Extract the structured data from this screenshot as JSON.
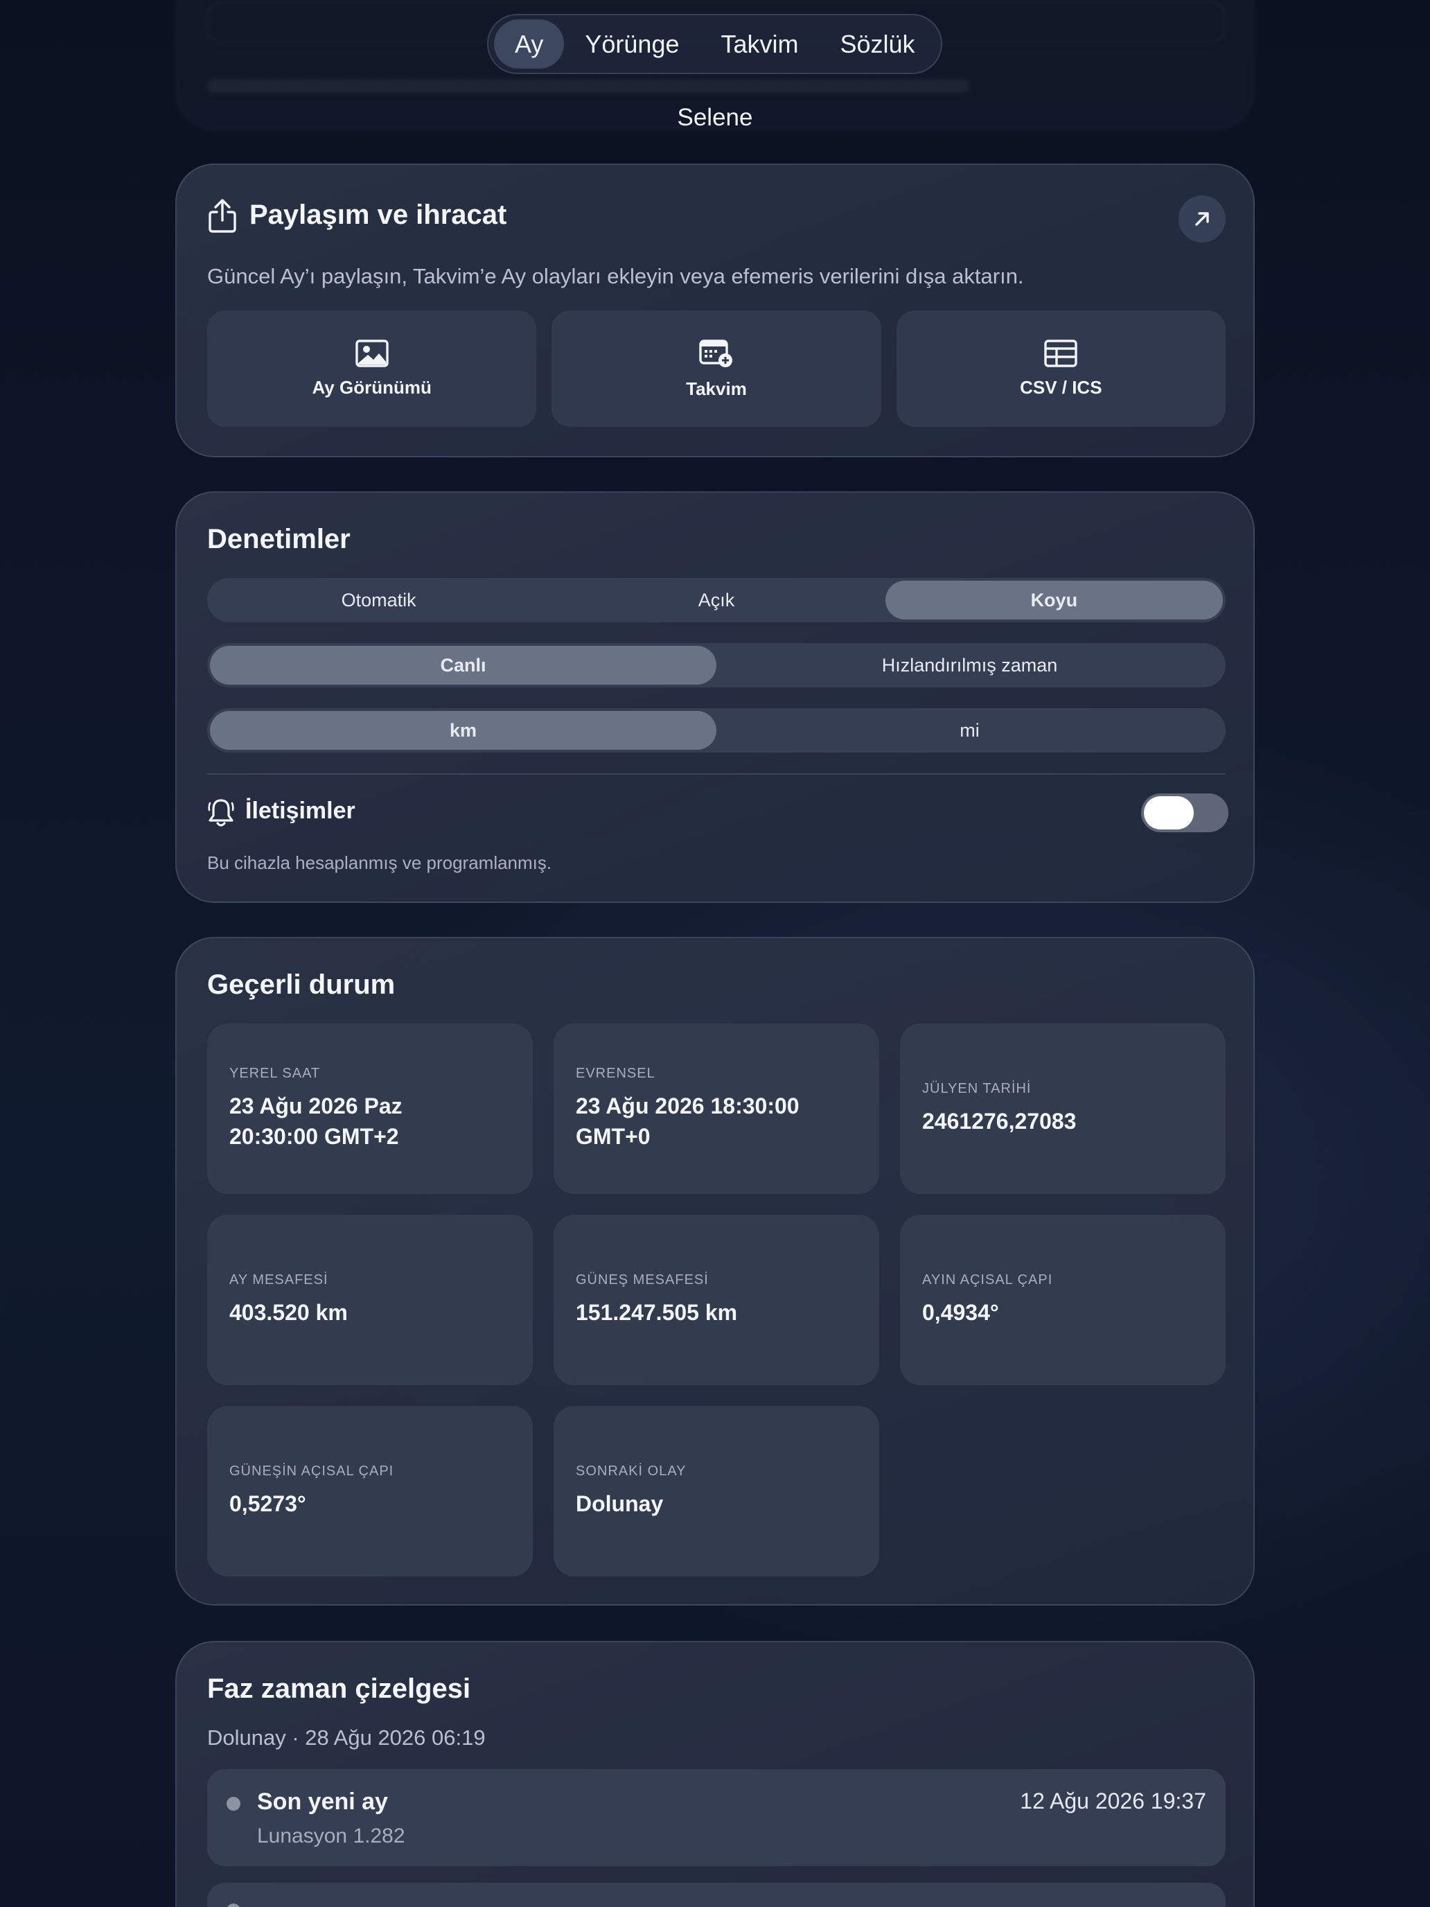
{
  "nav": {
    "tabs": [
      {
        "label": "Ay",
        "active": true
      },
      {
        "label": "Yörünge",
        "active": false
      },
      {
        "label": "Takvim",
        "active": false
      },
      {
        "label": "Sözlük",
        "active": false
      }
    ],
    "subtitle": "Selene"
  },
  "share": {
    "title": "Paylaşım ve ihracat",
    "description": "Güncel Ay’ı paylaşın, Takvim’e Ay olayları ekleyin veya efemeris verilerini dışa aktarın.",
    "options": [
      {
        "label": "Ay Görünümü",
        "icon": "image-icon"
      },
      {
        "label": "Takvim",
        "icon": "calendar-add-icon"
      },
      {
        "label": "CSV / ICS",
        "icon": "table-icon"
      }
    ]
  },
  "controls": {
    "title": "Denetimler",
    "theme": {
      "options": [
        "Otomatik",
        "Açık",
        "Koyu"
      ],
      "selected": "Koyu"
    },
    "time": {
      "options": [
        "Canlı",
        "Hızlandırılmış zaman"
      ],
      "selected": "Canlı"
    },
    "units": {
      "options": [
        "km",
        "mi"
      ],
      "selected": "km"
    },
    "notifications": {
      "label": "İletişimler",
      "description": "Bu cihazla hesaplanmış ve programlanmış.",
      "enabled": false
    }
  },
  "state": {
    "title": "Geçerli durum",
    "stats": [
      {
        "key": "YEREL SAAT",
        "value": "23 Ağu 2026 Paz\n20:30:00 GMT+2"
      },
      {
        "key": "EVRENSEL",
        "value": "23 Ağu 2026 18:30:00\nGMT+0"
      },
      {
        "key": "JÜLYEN TARİHİ",
        "value": "2461276,27083"
      },
      {
        "key": "AY MESAFESİ",
        "value": "403.520 km"
      },
      {
        "key": "GÜNEŞ MESAFESİ",
        "value": "151.247.505 km"
      },
      {
        "key": "AYIN AÇISAL ÇAPI",
        "value": "0,4934°"
      },
      {
        "key": "GÜNEŞİN AÇISAL ÇAPI",
        "value": "0,5273°"
      },
      {
        "key": "SONRAKİ OLAY",
        "value": "Dolunay"
      }
    ]
  },
  "timeline": {
    "title": "Faz zaman çizelgesi",
    "subtitle": "Dolunay · 28 Ağu 2026 06:19",
    "rows": [
      {
        "name": "Son yeni ay",
        "date": "12 Ağu 2026 19:37",
        "meta": "Lunasyon 1.282"
      }
    ]
  },
  "colors": {
    "accent_selected": "#6a7285",
    "card_bg": "#2c3448",
    "tile_bg": "#333b4f",
    "text_primary": "#f2f4f8",
    "text_secondary": "#a7afbf"
  }
}
